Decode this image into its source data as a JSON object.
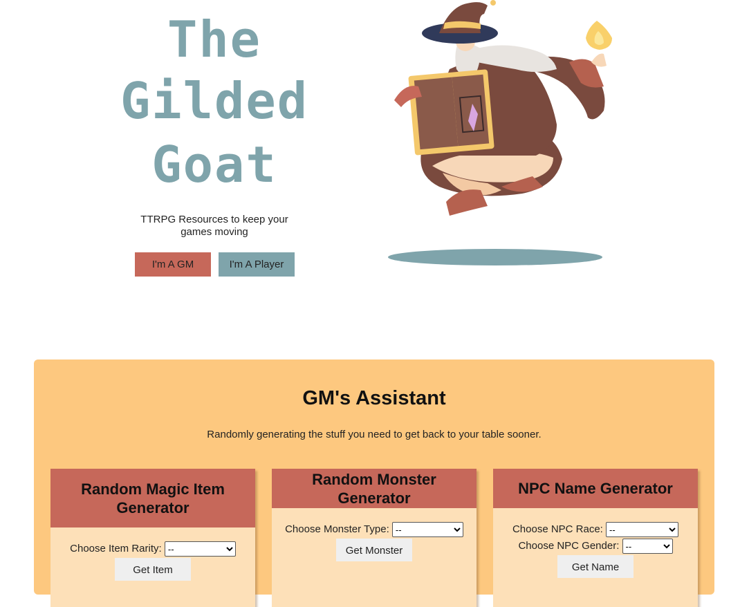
{
  "hero": {
    "title_line1": "The",
    "title_line2": "Gilded",
    "title_line3": "Goat",
    "subtitle": "TTRPG Resources to keep your games moving",
    "gm_button": "I'm A GM",
    "player_button": "I'm A Player"
  },
  "assistant": {
    "title": "GM's Assistant",
    "subtitle": "Randomly generating the stuff you need to get back to your table sooner.",
    "cards": [
      {
        "title": "Random Magic Item Generator",
        "field1_label": "Choose Item Rarity:",
        "field1_value": "--",
        "button": "Get Item"
      },
      {
        "title": "Random Monster Generator",
        "field1_label": "Choose Monster Type:",
        "field1_value": "--",
        "button": "Get Monster"
      },
      {
        "title": "NPC Name Generator",
        "field1_label": "Choose NPC Race:",
        "field1_value": "--",
        "field2_label": "Choose NPC Gender:",
        "field2_value": "--",
        "button": "Get Name"
      }
    ]
  },
  "colors": {
    "accent_red": "#c6685a",
    "accent_teal": "#7fa4ab",
    "panel_orange": "#fdc87f",
    "card_cream": "#fde0b8"
  },
  "icons": [
    "wizard-illustration"
  ]
}
